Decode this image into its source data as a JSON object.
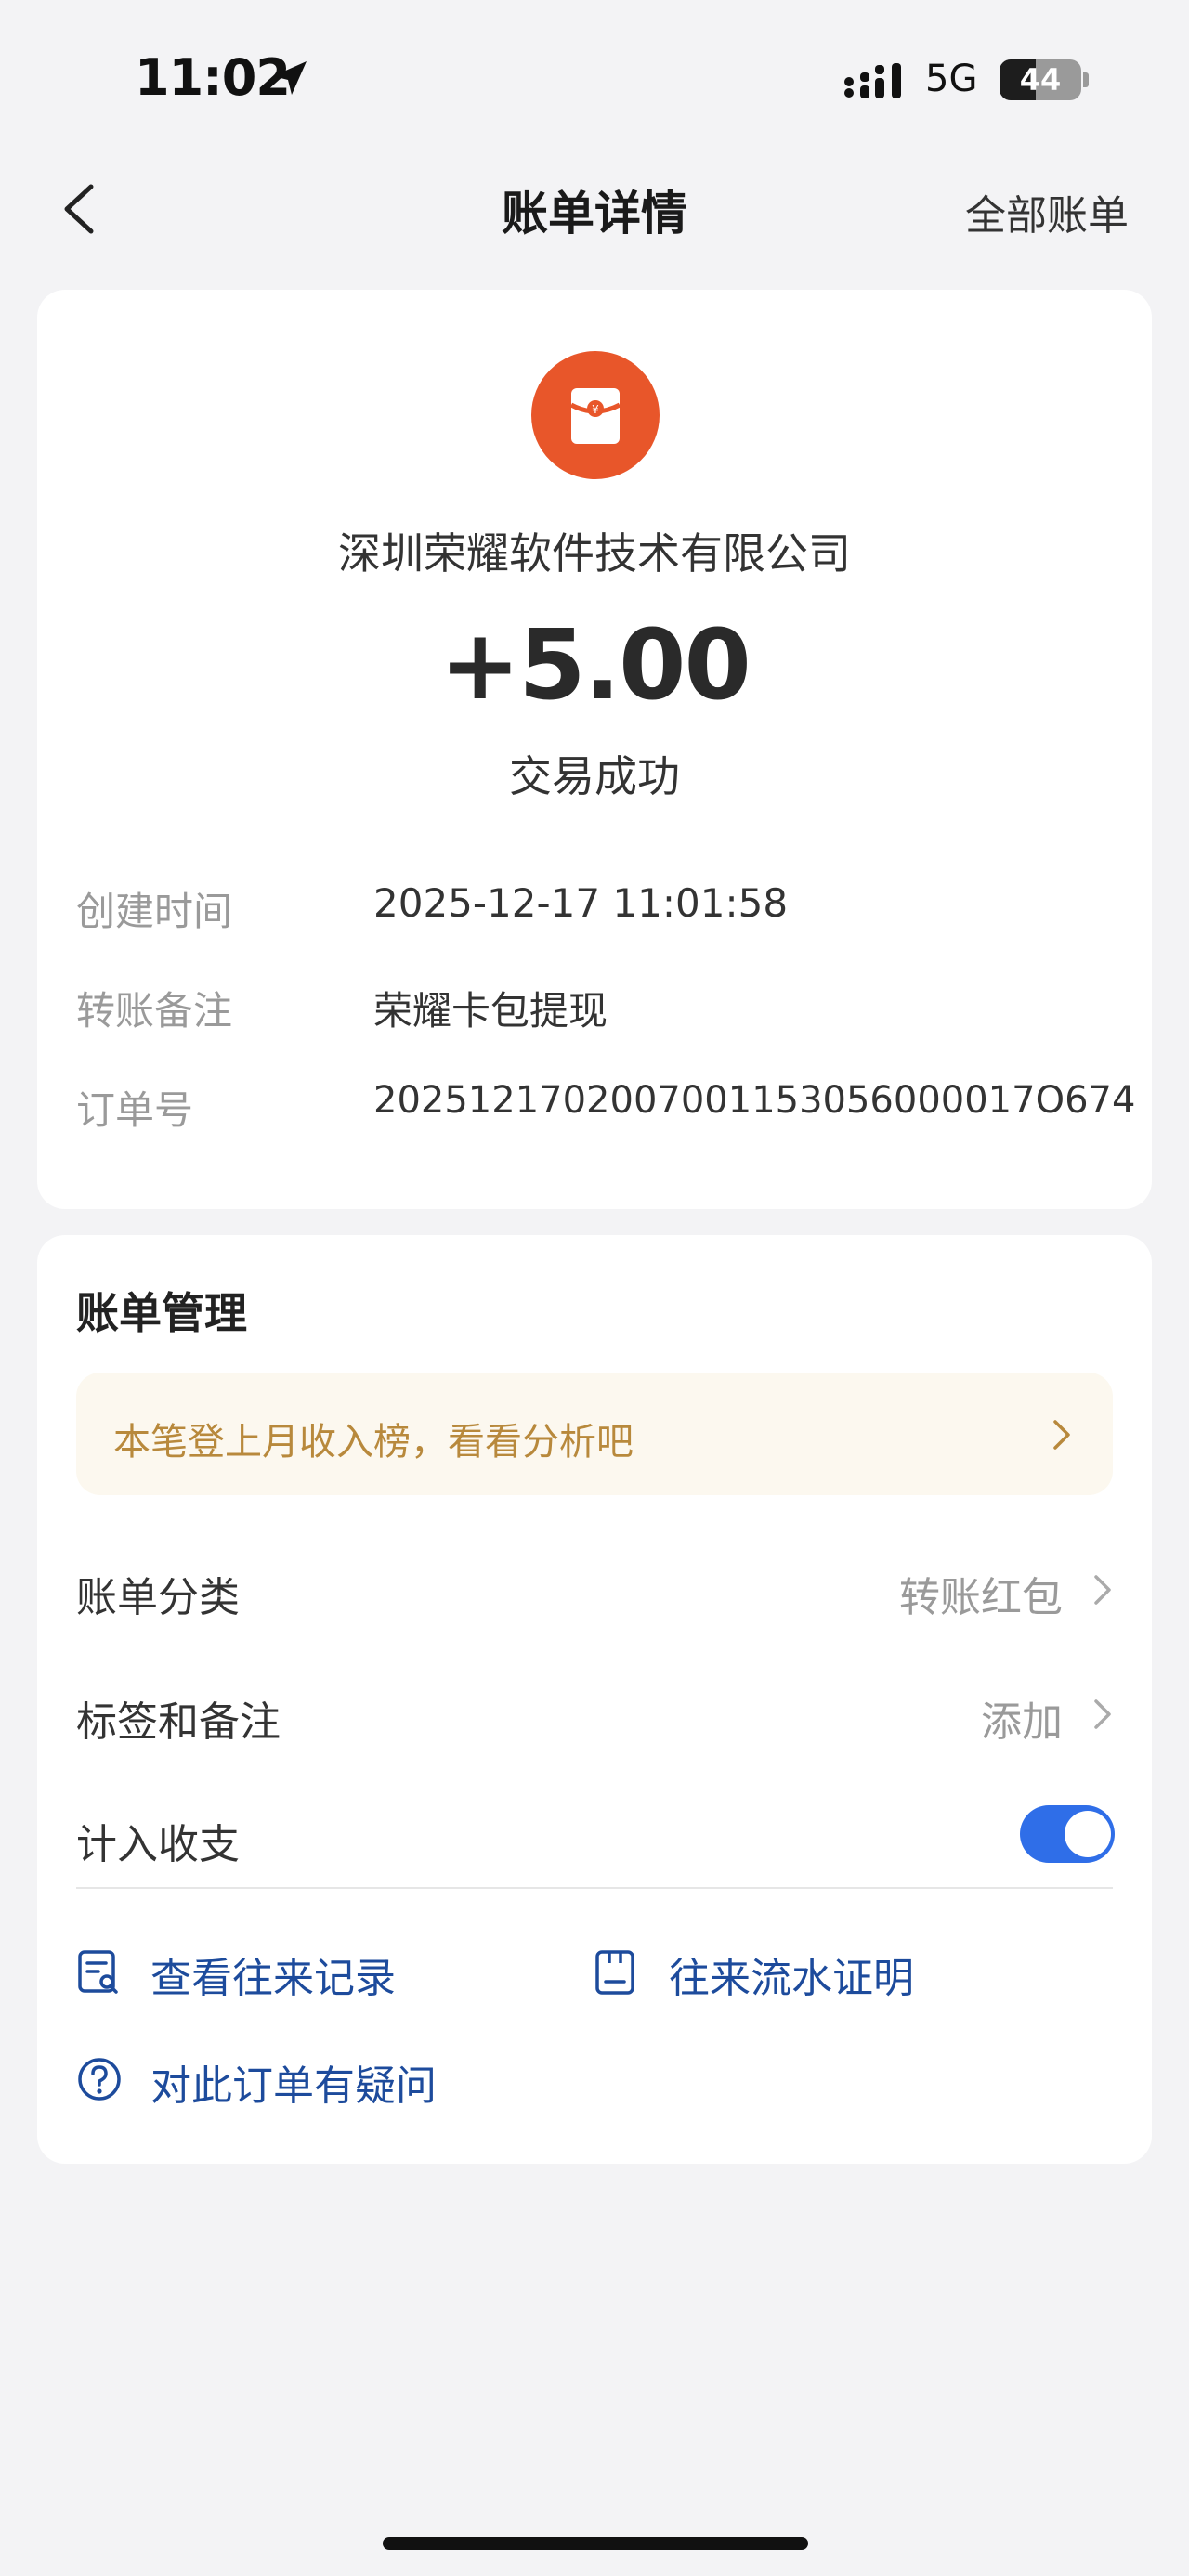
{
  "status_bar": {
    "time": "11:02",
    "network": "5G",
    "battery": "44",
    "battery_level": 0.44
  },
  "nav": {
    "title": "账单详情",
    "right": "全部账单"
  },
  "txn": {
    "payer": "深圳荣耀软件技术有限公司",
    "amount": "+5.00",
    "status": "交易成功",
    "details": [
      {
        "label": "创建时间",
        "value": "2025-12-17 11:01:58"
      },
      {
        "label": "转账备注",
        "value": "荣耀卡包提现"
      },
      {
        "label": "订单号",
        "value": "2025121702007001153056000017O674"
      }
    ]
  },
  "manage": {
    "title": "账单管理",
    "banner": "本笔登上月收入榜，看看分析吧",
    "category_label": "账单分类",
    "category_value": "转账红包",
    "tags_label": "标签和备注",
    "tags_value": "添加",
    "include_label": "计入收支",
    "include_on": true,
    "links": [
      "查看往来记录",
      "往来流水证明",
      "对此订单有疑问"
    ]
  },
  "colors": {
    "accent": "#2f6ee8",
    "logo": "#e8562a",
    "banner_text": "#b8893c",
    "link": "#1d4b9c"
  }
}
